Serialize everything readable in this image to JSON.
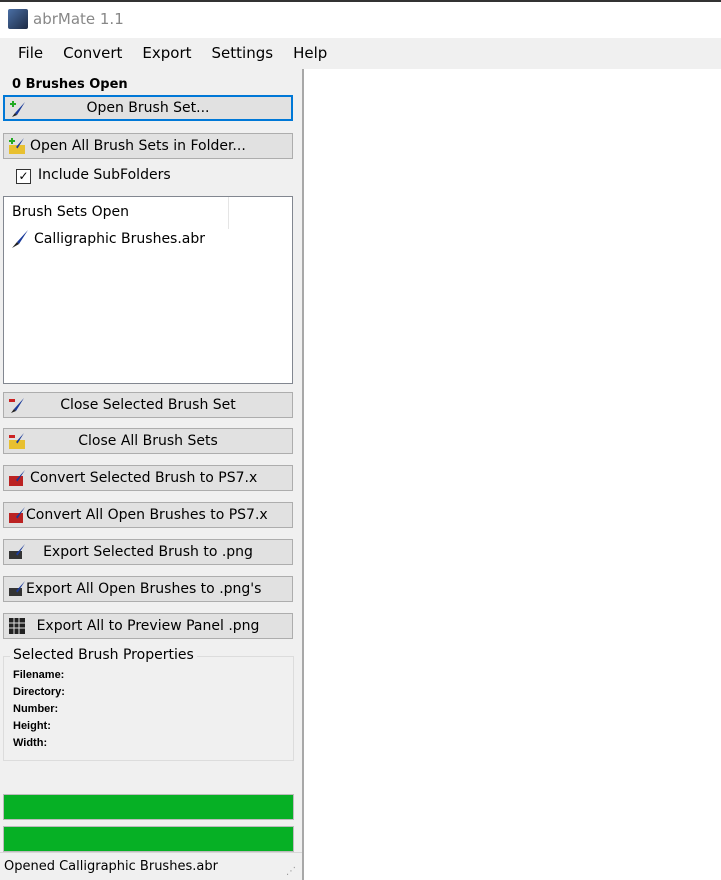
{
  "window": {
    "title": "abrMate 1.1"
  },
  "menu": [
    "File",
    "Convert",
    "Export",
    "Settings",
    "Help"
  ],
  "panel": {
    "count_label": "0 Brushes Open",
    "open_brush_set": "Open Brush Set...",
    "open_all_folder": "Open All Brush Sets in Folder...",
    "include_subfolders": {
      "label": "Include SubFolders",
      "checked": true
    },
    "list": {
      "header": "Brush Sets Open",
      "items": [
        "Calligraphic Brushes.abr"
      ]
    },
    "close_selected": "Close Selected Brush Set",
    "close_all": "Close All Brush Sets",
    "convert_selected": "Convert Selected Brush to PS7.x",
    "convert_all": "Convert All Open Brushes to PS7.x",
    "export_selected": "Export Selected Brush to .png",
    "export_all": "Export All Open Brushes to .png's",
    "export_preview": "Export All to Preview Panel .png",
    "properties": {
      "title": "Selected Brush Properties",
      "fields": [
        "Filename:",
        "Directory:",
        "Number:",
        "Height:",
        "Width:"
      ]
    },
    "progress": [
      100,
      100
    ],
    "progress_color": "#06b025",
    "status": "Opened Calligraphic Brushes.abr"
  }
}
